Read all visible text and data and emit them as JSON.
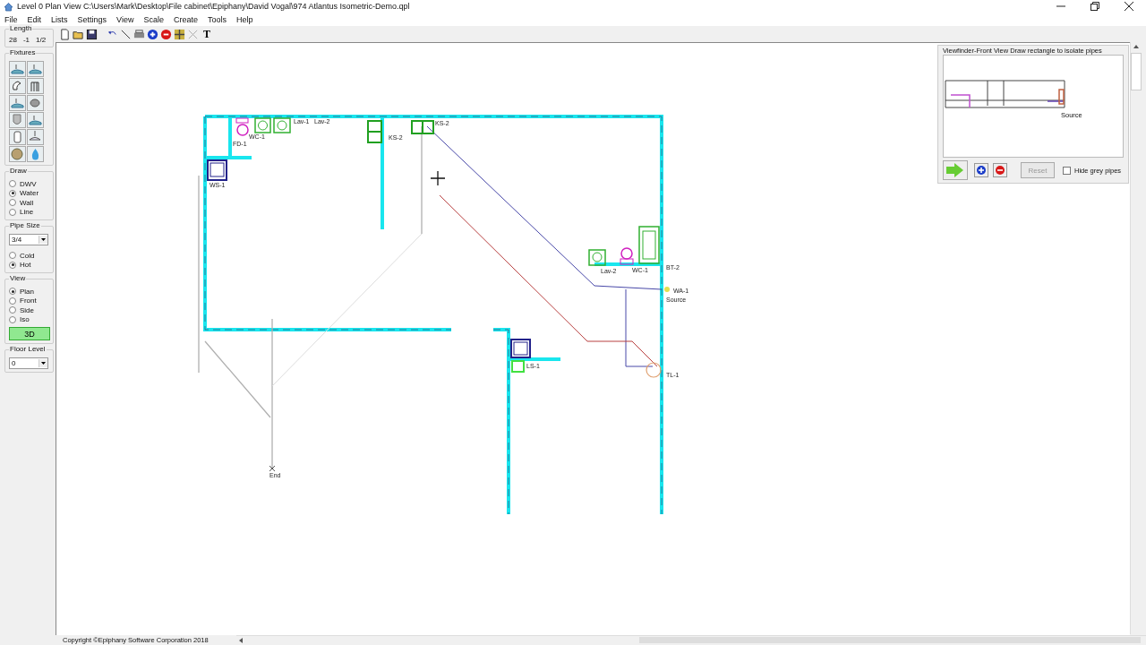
{
  "window": {
    "title": "Level 0 Plan View  C:\\Users\\Mark\\Desktop\\File cabinet\\Epiphany\\David Vogal\\974 Atlantus Isometric-Demo.qpl"
  },
  "menu": [
    "File",
    "Edit",
    "Lists",
    "Settings",
    "View",
    "Scale",
    "Create",
    "Tools",
    "Help"
  ],
  "length": {
    "label": "Length",
    "values": [
      "28",
      "-1",
      "1/2"
    ]
  },
  "toolbar": {
    "text_tool": "T"
  },
  "fixtures": {
    "label": "Fixtures"
  },
  "draw": {
    "label": "Draw",
    "options": [
      {
        "label": "DWV",
        "selected": false
      },
      {
        "label": "Water",
        "selected": true
      },
      {
        "label": "Wall",
        "selected": false
      },
      {
        "label": "Line",
        "selected": false
      }
    ]
  },
  "pipe_size": {
    "label": "Pipe Size",
    "value": "3/4",
    "options": [
      {
        "label": "Cold",
        "selected": false
      },
      {
        "label": "Hot",
        "selected": true
      }
    ]
  },
  "view": {
    "label": "View",
    "options": [
      {
        "label": "Plan",
        "selected": true
      },
      {
        "label": "Front",
        "selected": false
      },
      {
        "label": "Side",
        "selected": false
      },
      {
        "label": "Iso",
        "selected": false
      }
    ],
    "button": "3D"
  },
  "floor_level": {
    "label": "Floor Level",
    "value": "0"
  },
  "plan_labels": [
    "Lav-1",
    "Lav-2",
    "KS-2",
    "WC-1",
    "KS-2",
    "FD-1",
    "WS-1",
    "Lav-2",
    "WC-1",
    "BT-2",
    "WA-1",
    "Source",
    "LS-1",
    "TL-1",
    "End"
  ],
  "viewfinder": {
    "title": "Viewfinder-Front View  Draw rectangle to isolate pipes",
    "source_label": "Source",
    "reset_button": {
      "label": "Reset",
      "disabled": true
    },
    "hide_grey_pipes": {
      "label": "Hide grey pipes",
      "checked": false
    }
  },
  "status_bar": {
    "copyright": "Copyright ©Epiphany Software Corporation 2018"
  }
}
